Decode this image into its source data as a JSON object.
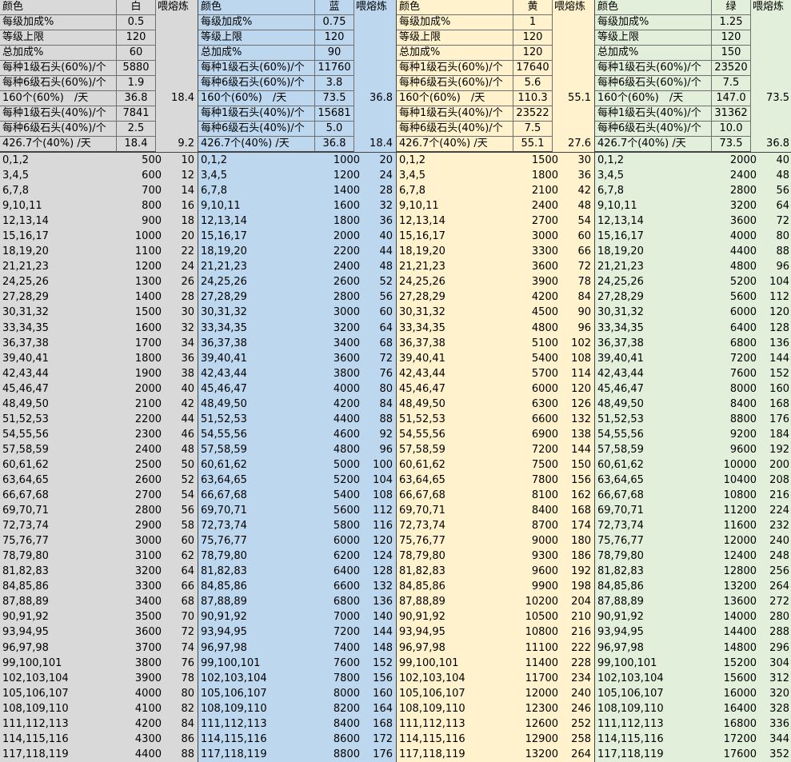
{
  "header_label": "颜色",
  "header_feed": "喂熔炼",
  "row_labels": [
    "每级加成%",
    "等级上限",
    "总加成%",
    "每种1级石头(60%)/个",
    "每种6级石头(60%)/个",
    "160个(60%)　/天",
    "每种1级石头(40%)/个",
    "每种6级石头(40%)/个",
    "426.7个(40%) /天"
  ],
  "level_groups": [
    "0,1,2",
    "3,4,5",
    "6,7,8",
    "9,10,11",
    "12,13,14",
    "15,16,17",
    "18,19,20",
    "21,21,23",
    "24,25,26",
    "27,28,29",
    "30,31,32",
    "33,34,35",
    "36,37,38",
    "39,40,41",
    "42,43,44",
    "45,46,47",
    "48,49,50",
    "51,52,53",
    "54,55,56",
    "57,58,59",
    "60,61,62",
    "63,64,65",
    "66,67,68",
    "69,70,71",
    "72,73,74",
    "75,76,77",
    "78,79,80",
    "81,82,83",
    "84,85,86",
    "87,88,89",
    "90,91,92",
    "93,94,95",
    "96,97,98",
    "99,100,101",
    "102,103,104",
    "105,106,107",
    "108,109,110",
    "111,112,113",
    "114,115,116",
    "117,118,119"
  ],
  "colors": {
    "white": "#d9d9d9",
    "blue": "#bdd7ee",
    "yellow": "#fff2cc",
    "green": "#e2efda"
  },
  "blocks": [
    {
      "id": "white",
      "color_name": "白",
      "top_values": [
        "0.5",
        "120",
        "60",
        "5880",
        "1.9",
        "36.8",
        "7841",
        "2.5",
        "18.4"
      ],
      "feed_160": "18.4",
      "feed_426": "9.2",
      "costs": [
        "500",
        "600",
        "700",
        "800",
        "900",
        "1000",
        "1100",
        "1200",
        "1300",
        "1400",
        "1500",
        "1600",
        "1700",
        "1800",
        "1900",
        "2000",
        "2100",
        "2200",
        "2300",
        "2400",
        "2500",
        "2600",
        "2700",
        "2800",
        "2900",
        "3000",
        "3100",
        "3200",
        "3300",
        "3400",
        "3500",
        "3600",
        "3700",
        "3800",
        "3900",
        "4000",
        "4100",
        "4200",
        "4300",
        "4400"
      ],
      "feeds": [
        "10",
        "12",
        "14",
        "16",
        "18",
        "20",
        "22",
        "24",
        "26",
        "28",
        "30",
        "32",
        "34",
        "36",
        "38",
        "40",
        "42",
        "44",
        "46",
        "48",
        "50",
        "52",
        "54",
        "56",
        "58",
        "60",
        "62",
        "64",
        "66",
        "68",
        "70",
        "72",
        "74",
        "76",
        "78",
        "80",
        "82",
        "84",
        "86",
        "88"
      ]
    },
    {
      "id": "blue",
      "color_name": "蓝",
      "top_values": [
        "0.75",
        "120",
        "90",
        "11760",
        "3.8",
        "73.5",
        "15681",
        "5.0",
        "36.8"
      ],
      "feed_160": "36.8",
      "feed_426": "18.4",
      "costs": [
        "1000",
        "1200",
        "1400",
        "1600",
        "1800",
        "2000",
        "2200",
        "2400",
        "2600",
        "2800",
        "3000",
        "3200",
        "3400",
        "3600",
        "3800",
        "4000",
        "4200",
        "4400",
        "4600",
        "4800",
        "5000",
        "5200",
        "5400",
        "5600",
        "5800",
        "6000",
        "6200",
        "6400",
        "6600",
        "6800",
        "7000",
        "7200",
        "7400",
        "7600",
        "7800",
        "8000",
        "8200",
        "8400",
        "8600",
        "8800"
      ],
      "feeds": [
        "20",
        "24",
        "28",
        "32",
        "36",
        "40",
        "44",
        "48",
        "52",
        "56",
        "60",
        "64",
        "68",
        "72",
        "76",
        "80",
        "84",
        "88",
        "92",
        "96",
        "100",
        "104",
        "108",
        "112",
        "116",
        "120",
        "124",
        "128",
        "132",
        "136",
        "140",
        "144",
        "148",
        "152",
        "156",
        "160",
        "164",
        "168",
        "172",
        "176"
      ]
    },
    {
      "id": "yellow",
      "color_name": "黄",
      "top_values": [
        "1",
        "120",
        "120",
        "17640",
        "5.6",
        "110.3",
        "23522",
        "7.5",
        "55.1"
      ],
      "feed_160": "55.1",
      "feed_426": "27.6",
      "costs": [
        "1500",
        "1800",
        "2100",
        "2400",
        "2700",
        "3000",
        "3300",
        "3600",
        "3900",
        "4200",
        "4500",
        "4800",
        "5100",
        "5400",
        "5700",
        "6000",
        "6300",
        "6600",
        "6900",
        "7200",
        "7500",
        "7800",
        "8100",
        "8400",
        "8700",
        "9000",
        "9300",
        "9600",
        "9900",
        "10200",
        "10500",
        "10800",
        "11100",
        "11400",
        "11700",
        "12000",
        "12300",
        "12600",
        "12900",
        "13200"
      ],
      "feeds": [
        "30",
        "36",
        "42",
        "48",
        "54",
        "60",
        "66",
        "72",
        "78",
        "84",
        "90",
        "96",
        "102",
        "108",
        "114",
        "120",
        "126",
        "132",
        "138",
        "144",
        "150",
        "156",
        "162",
        "168",
        "174",
        "180",
        "186",
        "192",
        "198",
        "204",
        "210",
        "216",
        "222",
        "228",
        "234",
        "240",
        "246",
        "252",
        "258",
        "264"
      ]
    },
    {
      "id": "green",
      "color_name": "绿",
      "top_values": [
        "1.25",
        "120",
        "150",
        "23520",
        "7.5",
        "147.0",
        "31362",
        "10.0",
        "73.5"
      ],
      "feed_160": "73.5",
      "feed_426": "36.8",
      "costs": [
        "2000",
        "2400",
        "2800",
        "3200",
        "3600",
        "4000",
        "4400",
        "4800",
        "5200",
        "5600",
        "6000",
        "6400",
        "6800",
        "7200",
        "7600",
        "8000",
        "8400",
        "8800",
        "9200",
        "9600",
        "10000",
        "10400",
        "10800",
        "11200",
        "11600",
        "12000",
        "12400",
        "12800",
        "13200",
        "13600",
        "14000",
        "14400",
        "14800",
        "15200",
        "15600",
        "16000",
        "16400",
        "16800",
        "17200",
        "17600"
      ],
      "feeds": [
        "40",
        "48",
        "56",
        "64",
        "72",
        "80",
        "88",
        "96",
        "104",
        "112",
        "120",
        "128",
        "136",
        "144",
        "152",
        "160",
        "168",
        "176",
        "184",
        "192",
        "200",
        "208",
        "216",
        "224",
        "232",
        "240",
        "248",
        "256",
        "264",
        "272",
        "280",
        "288",
        "296",
        "304",
        "312",
        "320",
        "328",
        "336",
        "344",
        "352"
      ]
    }
  ]
}
